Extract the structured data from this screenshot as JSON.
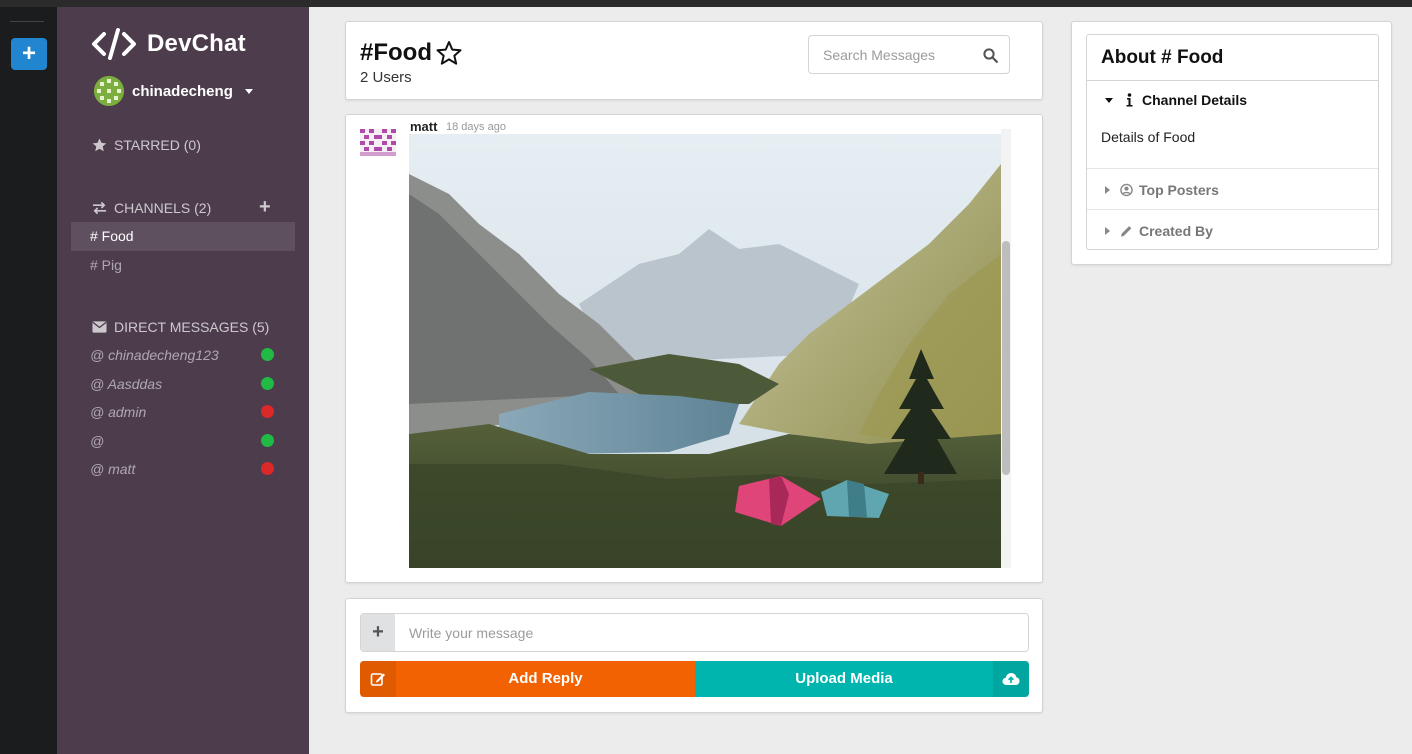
{
  "app": {
    "name": "DevChat"
  },
  "current_user": {
    "username": "chinadecheng"
  },
  "sidebar": {
    "starred_label": "STARRED (0)",
    "channels_label": "CHANNELS (2)",
    "channels": [
      {
        "label": "# Food",
        "active": true
      },
      {
        "label": "# Pig",
        "active": false
      }
    ],
    "dm_label": "DIRECT MESSAGES (5)",
    "direct_messages": [
      {
        "label": "@ chinadecheng123",
        "status": "online"
      },
      {
        "label": "@ Aasddas",
        "status": "online"
      },
      {
        "label": "@ admin",
        "status": "offline"
      },
      {
        "label": "@",
        "status": "online"
      },
      {
        "label": "@ matt",
        "status": "offline"
      }
    ]
  },
  "channel_header": {
    "title": "#Food",
    "users": "2 Users",
    "search_placeholder": "Search Messages"
  },
  "message": {
    "author": "matt",
    "time": "18 days ago"
  },
  "compose": {
    "placeholder": "Write your message",
    "reply_label": "Add Reply",
    "upload_label": "Upload Media"
  },
  "about": {
    "title": "About # Food",
    "channel_details_label": "Channel Details",
    "details_text": "Details of Food",
    "top_posters_label": "Top Posters",
    "created_by_label": "Created By"
  },
  "colors": {
    "sidebar": "#4c3c4c",
    "rail": "#1b1c1d",
    "primary_blue": "#2185d0",
    "reply_orange": "#f26202",
    "upload_teal": "#00b5ad",
    "online": "#21ba45",
    "offline": "#db2828"
  },
  "icons": {
    "brand": "code-icon",
    "starred": "star-icon",
    "channels": "exchange-icon",
    "dm": "mail-icon",
    "favorite": "star-outline-icon",
    "search": "search-icon",
    "reply": "edit-icon",
    "upload": "cloud-upload-icon",
    "channel_details": "info-icon",
    "top_posters": "user-circle-icon",
    "created_by": "pencil-icon"
  }
}
